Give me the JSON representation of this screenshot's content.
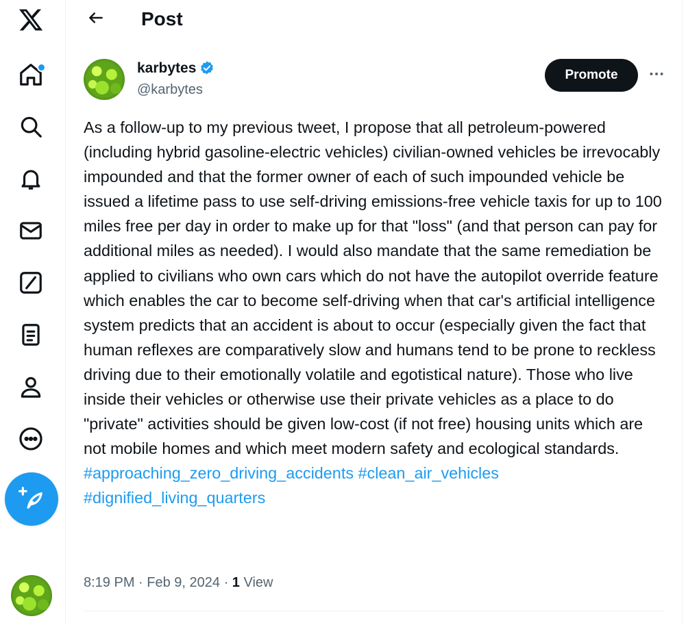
{
  "sidebar": {
    "items": [
      {
        "icon": "x-logo-icon"
      },
      {
        "icon": "home-icon",
        "has_notification": true
      },
      {
        "icon": "search-icon"
      },
      {
        "icon": "bell-icon"
      },
      {
        "icon": "mail-icon"
      },
      {
        "icon": "grok-icon"
      },
      {
        "icon": "lists-icon"
      },
      {
        "icon": "profile-icon"
      },
      {
        "icon": "more-circle-icon"
      }
    ],
    "compose_icon": "compose-feather-icon"
  },
  "header": {
    "back_icon": "back-arrow-icon",
    "title": "Post"
  },
  "post": {
    "author_name": "karbytes",
    "author_handle": "@karbytes",
    "verified_icon": "verified-badge-icon",
    "promote_label": "Promote",
    "more_icon": "more-horizontal-icon",
    "text": "As a follow-up to my previous tweet, I propose that all petroleum-powered (including hybrid gasoline-electric vehicles) civilian-owned vehicles be irrevocably impounded and that the former owner of each of such impounded vehicle be issued a lifetime pass to use self-driving emissions-free vehicle taxis for up to 100 miles free per day in order to make up for that \"loss\" (and that person can pay for additional miles as needed). I would also mandate that the same remediation be applied to civilians who own cars which do not have the autopilot override feature which enables the car to become self-driving when that car's artificial intelligence system predicts that an accident is about to occur (especially given the fact that human reflexes are comparatively slow and humans tend to be prone to reckless driving due to their emotionally volatile and egotistical nature). Those who live inside their vehicles or otherwise use their private vehicles as a place to do \"private\" activities should be given low-cost (if not free) housing units which are not mobile homes and which meet modern safety and ecological standards.",
    "hashtags": [
      "#approaching_zero_driving_accidents",
      "#clean_air_vehicles",
      "#dignified_living_quarters"
    ],
    "time": "8:19 PM",
    "separator": " · ",
    "date": "Feb 9, 2024",
    "views_count": "1",
    "views_label": " View"
  },
  "colors": {
    "accent": "#1d9bf0",
    "text": "#0f1419",
    "secondary": "#536471",
    "divider": "#eff3f4"
  }
}
